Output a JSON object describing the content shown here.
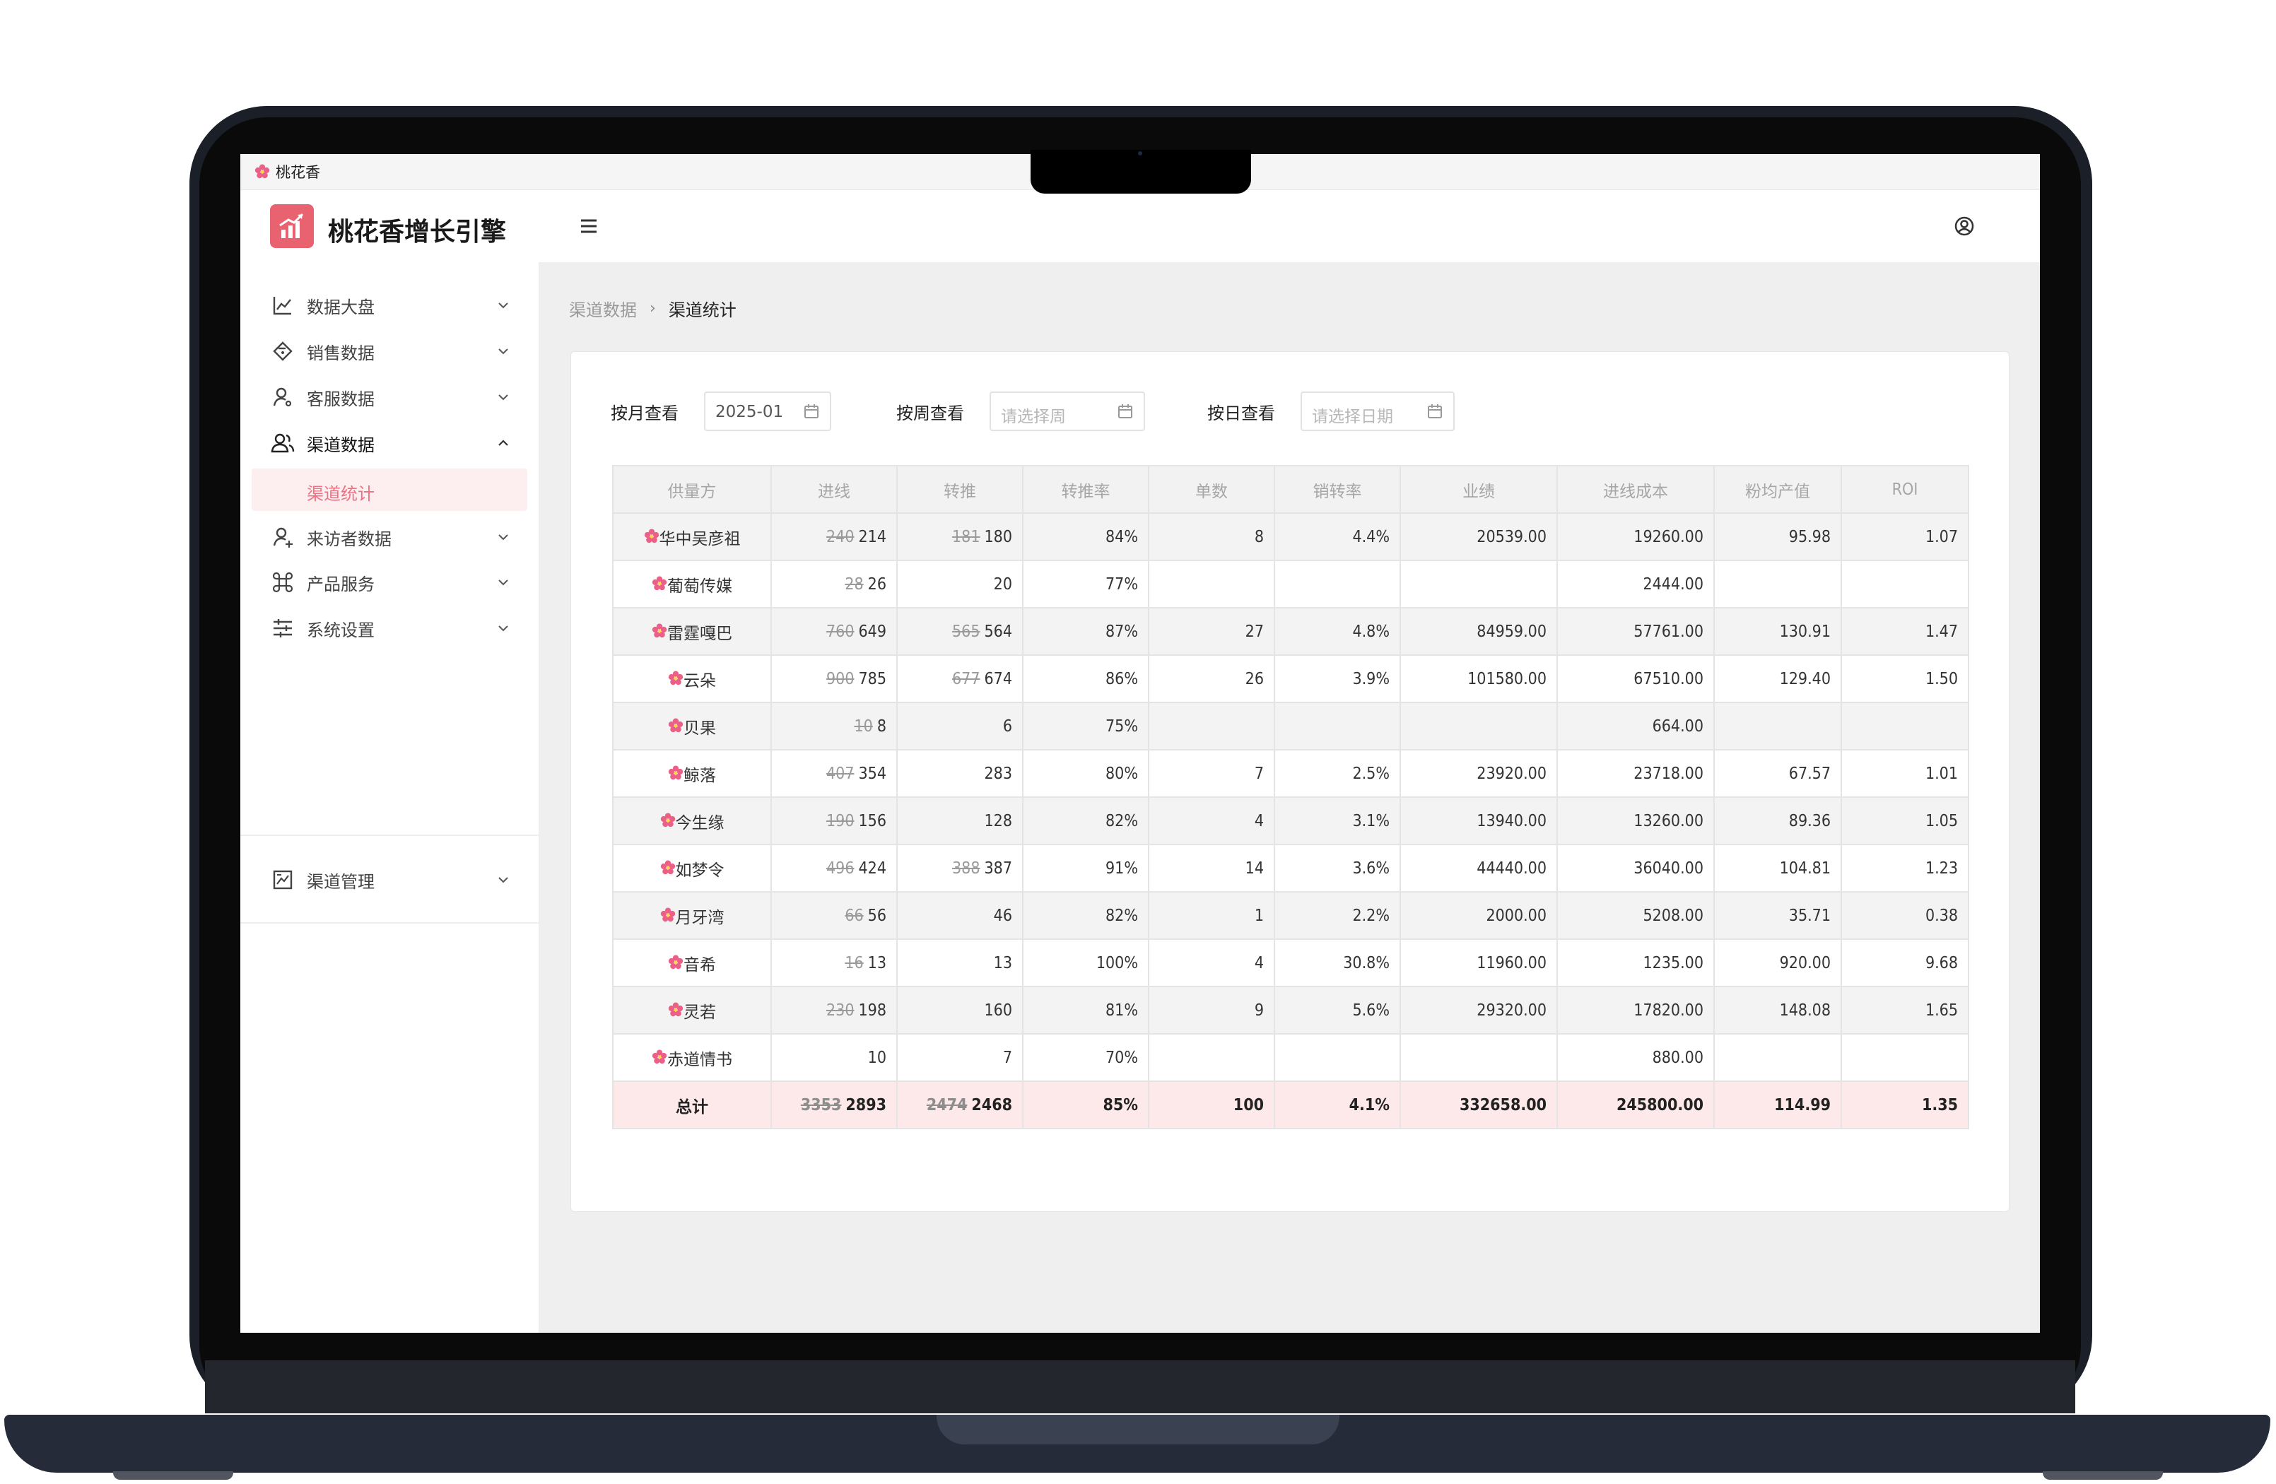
{
  "tab": {
    "title": "桃花香"
  },
  "header": {
    "app_title": "桃花香增长引擎"
  },
  "sidebar": {
    "items": [
      {
        "label": "数据大盘",
        "icon": "line-chart-icon",
        "expanded": false
      },
      {
        "label": "销售数据",
        "icon": "tag-icon",
        "expanded": false
      },
      {
        "label": "客服数据",
        "icon": "user-service-icon",
        "expanded": false
      },
      {
        "label": "渠道数据",
        "icon": "team-icon",
        "expanded": true
      },
      {
        "label": "来访者数据",
        "icon": "visitor-icon",
        "expanded": false
      },
      {
        "label": "产品服务",
        "icon": "command-icon",
        "expanded": false
      },
      {
        "label": "系统设置",
        "icon": "sliders-icon",
        "expanded": false
      }
    ],
    "sub_item": "渠道统计",
    "bottom_item": {
      "label": "渠道管理",
      "icon": "stock-icon"
    }
  },
  "breadcrumb": {
    "parent": "渠道数据",
    "current": "渠道统计"
  },
  "filters": {
    "month": {
      "label": "按月查看",
      "value": "2025-01"
    },
    "week": {
      "label": "按周查看",
      "placeholder": "请选择周"
    },
    "day": {
      "label": "按日查看",
      "placeholder": "请选择日期"
    }
  },
  "table": {
    "columns": [
      "供量方",
      "进线",
      "转推",
      "转推率",
      "单数",
      "销转率",
      "业绩",
      "进线成本",
      "粉均产值",
      "ROI"
    ],
    "rows": [
      {
        "name": "华中吴彦祖",
        "in_old": "240",
        "in": "214",
        "push_old": "181",
        "push": "180",
        "push_rate": "84%",
        "orders": "8",
        "conv_rate": "4.4%",
        "sales": "20539.00",
        "cost": "19260.00",
        "per_fan": "95.98",
        "roi": "1.07"
      },
      {
        "name": "葡萄传媒",
        "in_old": "28",
        "in": "26",
        "push_old": "",
        "push": "20",
        "push_rate": "77%",
        "orders": "",
        "conv_rate": "",
        "sales": "",
        "cost": "2444.00",
        "per_fan": "",
        "roi": ""
      },
      {
        "name": "雷霆嘎巴",
        "in_old": "760",
        "in": "649",
        "push_old": "565",
        "push": "564",
        "push_rate": "87%",
        "orders": "27",
        "conv_rate": "4.8%",
        "sales": "84959.00",
        "cost": "57761.00",
        "per_fan": "130.91",
        "roi": "1.47"
      },
      {
        "name": "云朵",
        "in_old": "900",
        "in": "785",
        "push_old": "677",
        "push": "674",
        "push_rate": "86%",
        "orders": "26",
        "conv_rate": "3.9%",
        "sales": "101580.00",
        "cost": "67510.00",
        "per_fan": "129.40",
        "roi": "1.50"
      },
      {
        "name": "贝果",
        "in_old": "10",
        "in": "8",
        "push_old": "",
        "push": "6",
        "push_rate": "75%",
        "orders": "",
        "conv_rate": "",
        "sales": "",
        "cost": "664.00",
        "per_fan": "",
        "roi": ""
      },
      {
        "name": "鲸落",
        "in_old": "407",
        "in": "354",
        "push_old": "",
        "push": "283",
        "push_rate": "80%",
        "orders": "7",
        "conv_rate": "2.5%",
        "sales": "23920.00",
        "cost": "23718.00",
        "per_fan": "67.57",
        "roi": "1.01"
      },
      {
        "name": "今生缘",
        "in_old": "190",
        "in": "156",
        "push_old": "",
        "push": "128",
        "push_rate": "82%",
        "orders": "4",
        "conv_rate": "3.1%",
        "sales": "13940.00",
        "cost": "13260.00",
        "per_fan": "89.36",
        "roi": "1.05"
      },
      {
        "name": "如梦令",
        "in_old": "496",
        "in": "424",
        "push_old": "388",
        "push": "387",
        "push_rate": "91%",
        "orders": "14",
        "conv_rate": "3.6%",
        "sales": "44440.00",
        "cost": "36040.00",
        "per_fan": "104.81",
        "roi": "1.23"
      },
      {
        "name": "月牙湾",
        "in_old": "66",
        "in": "56",
        "push_old": "",
        "push": "46",
        "push_rate": "82%",
        "orders": "1",
        "conv_rate": "2.2%",
        "sales": "2000.00",
        "cost": "5208.00",
        "per_fan": "35.71",
        "roi": "0.38"
      },
      {
        "name": "音希",
        "in_old": "16",
        "in": "13",
        "push_old": "",
        "push": "13",
        "push_rate": "100%",
        "orders": "4",
        "conv_rate": "30.8%",
        "sales": "11960.00",
        "cost": "1235.00",
        "per_fan": "920.00",
        "roi": "9.68"
      },
      {
        "name": "灵若",
        "in_old": "230",
        "in": "198",
        "push_old": "",
        "push": "160",
        "push_rate": "81%",
        "orders": "9",
        "conv_rate": "5.6%",
        "sales": "29320.00",
        "cost": "17820.00",
        "per_fan": "148.08",
        "roi": "1.65"
      },
      {
        "name": "赤道情书",
        "in_old": "",
        "in": "10",
        "push_old": "",
        "push": "7",
        "push_rate": "70%",
        "orders": "",
        "conv_rate": "",
        "sales": "",
        "cost": "880.00",
        "per_fan": "",
        "roi": ""
      }
    ],
    "total": {
      "name": "总计",
      "in_old": "3353",
      "in": "2893",
      "push_old": "2474",
      "push": "2468",
      "push_rate": "85%",
      "orders": "100",
      "conv_rate": "4.1%",
      "sales": "332658.00",
      "cost": "245800.00",
      "per_fan": "114.99",
      "roi": "1.35"
    }
  },
  "colors": {
    "accent": "#ef7283",
    "logo": "#e9626f",
    "total_row": "#fde9ea",
    "flower": "#ec5f86"
  }
}
